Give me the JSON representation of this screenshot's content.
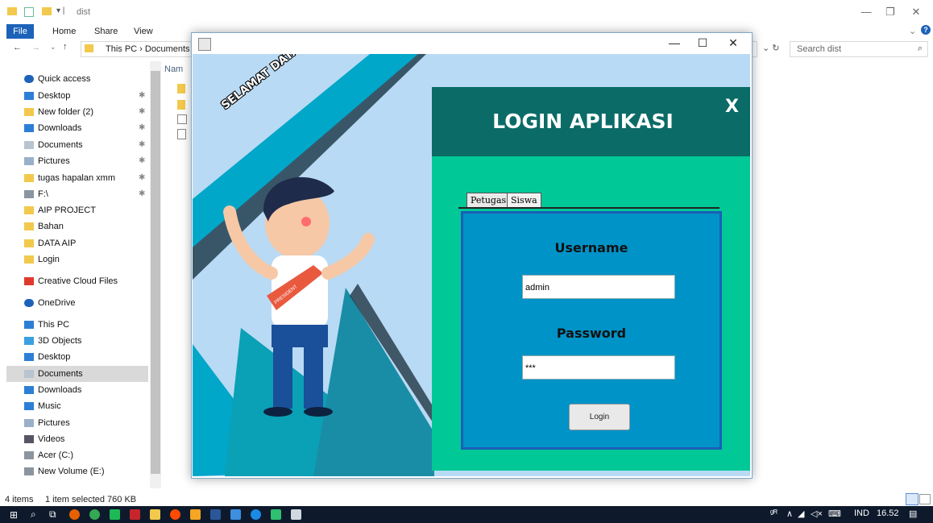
{
  "explorer": {
    "title": "dist",
    "ribbon_tabs": [
      "File",
      "Home",
      "Share",
      "View"
    ],
    "address_path": "This PC  ›  Documents",
    "search_placeholder": "Search dist",
    "column_header": "Nam",
    "nav_items": [
      {
        "label": "Quick access",
        "icon": "star-icon",
        "pinned": false
      },
      {
        "label": "Desktop",
        "icon": "desktop-icon",
        "pinned": true
      },
      {
        "label": "New folder (2)",
        "icon": "folder-icon",
        "pinned": true
      },
      {
        "label": "Downloads",
        "icon": "download-icon",
        "pinned": true
      },
      {
        "label": "Documents",
        "icon": "documents-icon",
        "pinned": true
      },
      {
        "label": "Pictures",
        "icon": "pictures-icon",
        "pinned": true
      },
      {
        "label": "tugas hapalan xmm",
        "icon": "folder-icon",
        "pinned": true
      },
      {
        "label": "F:\\",
        "icon": "drive-icon",
        "pinned": true
      },
      {
        "label": "AIP PROJECT",
        "icon": "folder-icon",
        "pinned": false
      },
      {
        "label": "Bahan",
        "icon": "folder-icon",
        "pinned": false
      },
      {
        "label": "DATA AIP",
        "icon": "folder-icon",
        "pinned": false
      },
      {
        "label": "Login",
        "icon": "folder-icon",
        "pinned": false
      },
      {
        "label": "Creative Cloud Files",
        "icon": "creative-cloud-icon",
        "pinned": false
      },
      {
        "label": "OneDrive",
        "icon": "cloud-icon",
        "pinned": false
      },
      {
        "label": "This PC",
        "icon": "computer-icon",
        "pinned": false
      },
      {
        "label": "3D Objects",
        "icon": "cube-icon",
        "pinned": false
      },
      {
        "label": "Desktop",
        "icon": "desktop-icon",
        "pinned": false
      },
      {
        "label": "Documents",
        "icon": "documents-icon",
        "pinned": false
      },
      {
        "label": "Downloads",
        "icon": "download-icon",
        "pinned": false
      },
      {
        "label": "Music",
        "icon": "music-icon",
        "pinned": false
      },
      {
        "label": "Pictures",
        "icon": "pictures-icon",
        "pinned": false
      },
      {
        "label": "Videos",
        "icon": "video-icon",
        "pinned": false
      },
      {
        "label": "Acer (C:)",
        "icon": "drive-icon",
        "pinned": false
      },
      {
        "label": "New Volume (E:)",
        "icon": "drive-icon",
        "pinned": false
      }
    ],
    "status_items": "4 items",
    "status_selected": "1 item selected  760 KB"
  },
  "login_app": {
    "banner_text": "SELAMAT DATANG",
    "sash_text": "PRESIDENT",
    "title": "LOGIN APLIKASI",
    "close_label": "X",
    "tabs": [
      "Petugas",
      "Siswa"
    ],
    "username_label": "Username",
    "username_value": "admin",
    "password_label": "Password",
    "password_value": "***",
    "login_button": "Login"
  },
  "taskbar": {
    "language": "IND",
    "time": "16.52"
  },
  "colors": {
    "login_header": "#0b6b67",
    "login_body": "#00c896",
    "form_box": "#0093c8",
    "banner": "#00a7c9",
    "taskbar": "#0e1a2c"
  }
}
